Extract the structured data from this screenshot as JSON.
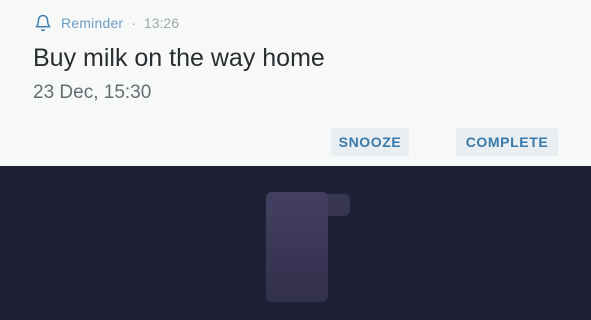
{
  "notification": {
    "icon": "bell-icon",
    "app_name": "Reminder",
    "separator": "·",
    "time": "13:26",
    "title": "Buy milk on the way home",
    "subtitle": "23 Dec, 15:30",
    "actions": {
      "snooze": "SNOOZE",
      "complete": "COMPLETE"
    }
  },
  "colors": {
    "notification_bg": "#f7f9f9",
    "accent": "#3a79a8",
    "background": "#1e2036"
  }
}
